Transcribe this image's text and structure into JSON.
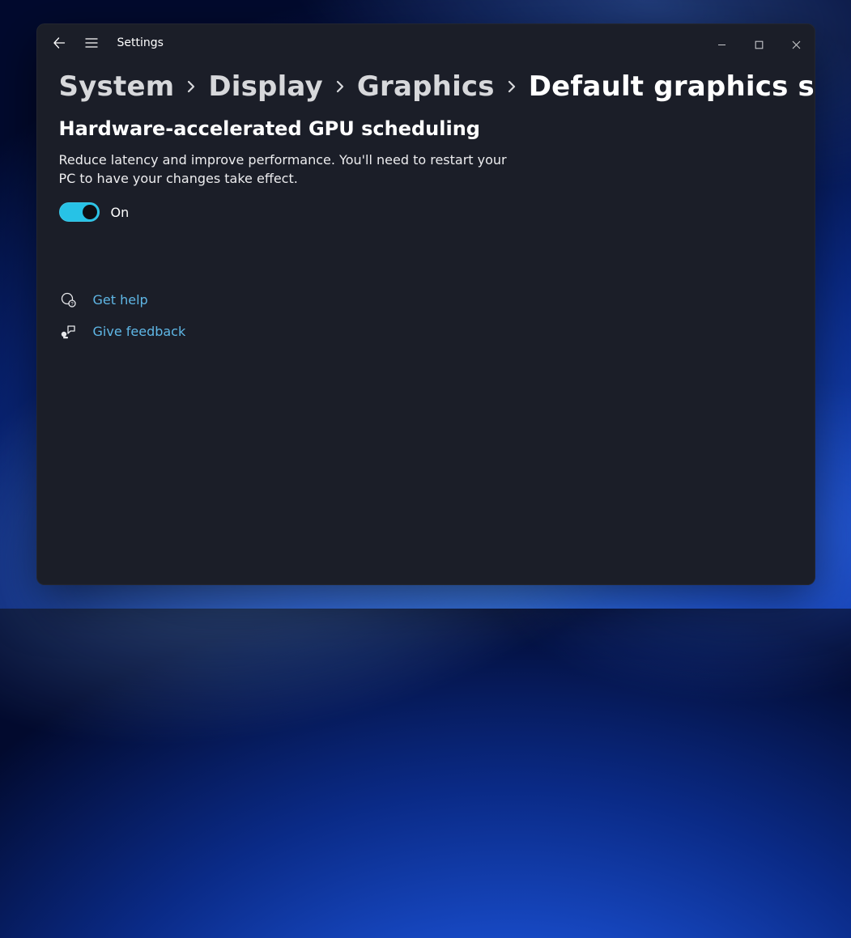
{
  "titlebar": {
    "app_title": "Settings"
  },
  "breadcrumb": {
    "items": [
      "System",
      "Display",
      "Graphics"
    ],
    "current": "Default graphics settings"
  },
  "section": {
    "heading": "Hardware-accelerated GPU scheduling",
    "description": "Reduce latency and improve performance. You'll need to restart your PC to have your changes take effect.",
    "toggle_state_label": "On"
  },
  "help": {
    "get_help": "Get help",
    "give_feedback": "Give feedback"
  }
}
